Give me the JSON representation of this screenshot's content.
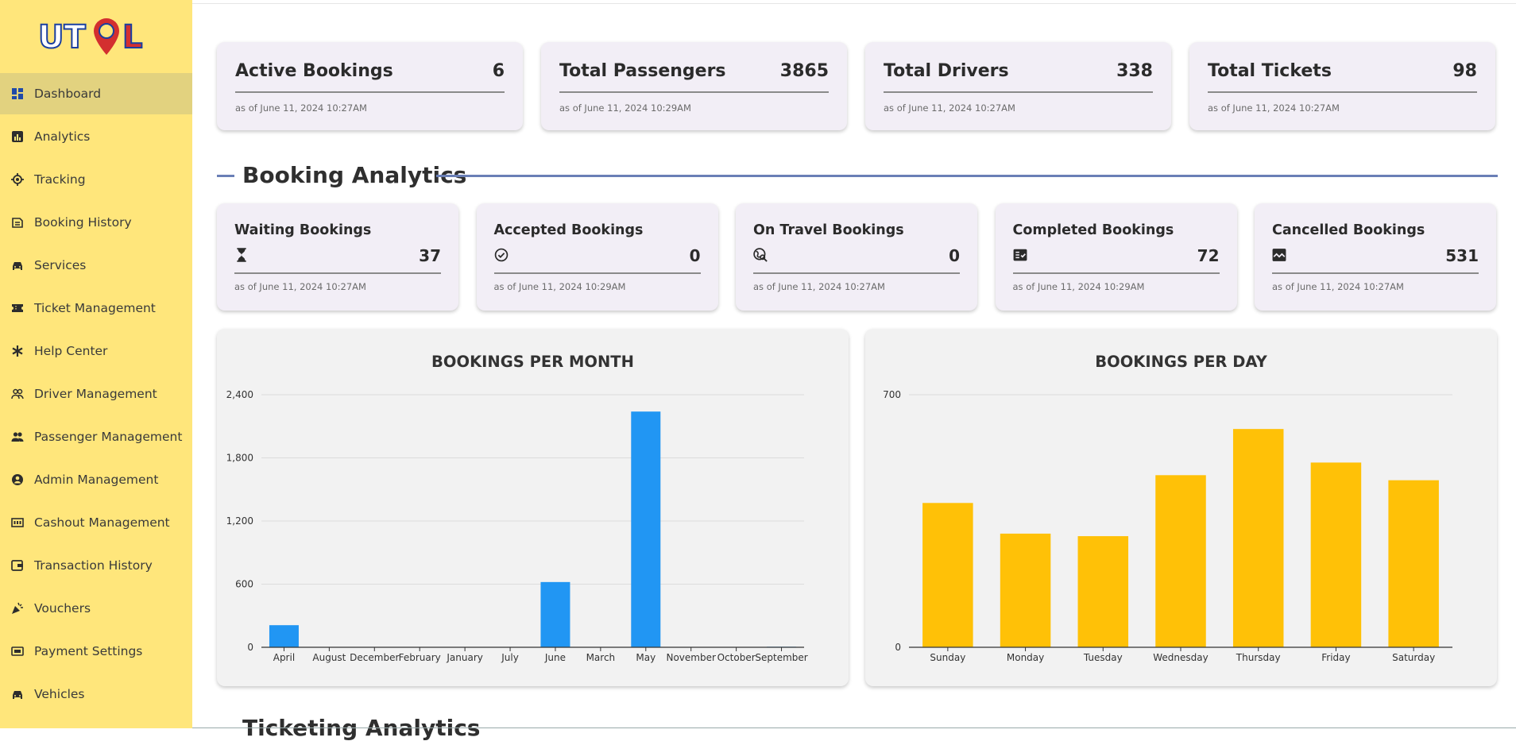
{
  "brand": {
    "logo_text": "UTOL"
  },
  "sidebar": {
    "items": [
      {
        "label": "Dashboard",
        "icon": "dashboard-icon",
        "active": true
      },
      {
        "label": "Analytics",
        "icon": "analytics-icon"
      },
      {
        "label": "Tracking",
        "icon": "tracking-icon"
      },
      {
        "label": "Booking History",
        "icon": "booking-history-icon"
      },
      {
        "label": "Services",
        "icon": "car-icon"
      },
      {
        "label": "Ticket Management",
        "icon": "ticket-icon"
      },
      {
        "label": "Help Center",
        "icon": "asterisk-icon"
      },
      {
        "label": "Driver Management",
        "icon": "drivers-icon"
      },
      {
        "label": "Passenger Management",
        "icon": "passengers-icon"
      },
      {
        "label": "Admin Management",
        "icon": "admin-icon"
      },
      {
        "label": "Cashout Management",
        "icon": "cashout-icon"
      },
      {
        "label": "Transaction History",
        "icon": "wallet-icon"
      },
      {
        "label": "Vouchers",
        "icon": "voucher-icon"
      },
      {
        "label": "Payment Settings",
        "icon": "payment-icon"
      },
      {
        "label": "Vehicles",
        "icon": "vehicle-icon"
      }
    ]
  },
  "summary_cards": [
    {
      "title": "Active Bookings",
      "value": "6",
      "asof": "as of June 11, 2024 10:27AM"
    },
    {
      "title": "Total Passengers",
      "value": "3865",
      "asof": "as of June 11, 2024 10:29AM"
    },
    {
      "title": "Total Drivers",
      "value": "338",
      "asof": "as of June 11, 2024 10:27AM"
    },
    {
      "title": "Total Tickets",
      "value": "98",
      "asof": "as of June 11, 2024 10:27AM"
    }
  ],
  "booking_analytics": {
    "heading": "Booking Analytics",
    "cards": [
      {
        "title": "Waiting Bookings",
        "value": "37",
        "icon": "hourglass-icon",
        "asof": "as of June 11, 2024 10:27AM"
      },
      {
        "title": "Accepted Bookings",
        "value": "0",
        "icon": "check-circle-icon",
        "asof": "as of June 11, 2024 10:29AM"
      },
      {
        "title": "On Travel Bookings",
        "value": "0",
        "icon": "travel-explore-icon",
        "asof": "as of June 11, 2024 10:27AM"
      },
      {
        "title": "Completed Bookings",
        "value": "72",
        "icon": "fact-check-icon",
        "asof": "as of June 11, 2024 10:29AM"
      },
      {
        "title": "Cancelled Bookings",
        "value": "531",
        "icon": "broken-image-icon",
        "asof": "as of June 11, 2024 10:27AM"
      }
    ]
  },
  "colors": {
    "month_bar": "#2196f3",
    "day_bar": "#ffc107",
    "sidebar": "#ffe67b",
    "accent_line": "#6a7fb6"
  },
  "chart_data": [
    {
      "type": "bar",
      "title": "BOOKINGS PER MONTH",
      "categories": [
        "April",
        "August",
        "December",
        "February",
        "January",
        "July",
        "June",
        "March",
        "May",
        "November",
        "October",
        "September"
      ],
      "values": [
        210,
        0,
        0,
        0,
        0,
        0,
        620,
        0,
        2240,
        0,
        0,
        5
      ],
      "ylim": [
        0,
        2400
      ],
      "yticks": [
        "0",
        "600",
        "1,200",
        "1,800",
        "2,400"
      ],
      "grid": true,
      "legend": "none"
    },
    {
      "type": "bar",
      "title": "BOOKINGS PER DAY",
      "categories": [
        "Sunday",
        "Monday",
        "Tuesday",
        "Wednesday",
        "Thursday",
        "Friday",
        "Saturday"
      ],
      "values": [
        400,
        315,
        308,
        477,
        605,
        512,
        463
      ],
      "ylim": [
        0,
        700
      ],
      "yticks": [
        "0",
        "700"
      ],
      "grid": true,
      "legend": "none"
    }
  ],
  "next_section": {
    "heading": "Ticketing Analytics"
  }
}
